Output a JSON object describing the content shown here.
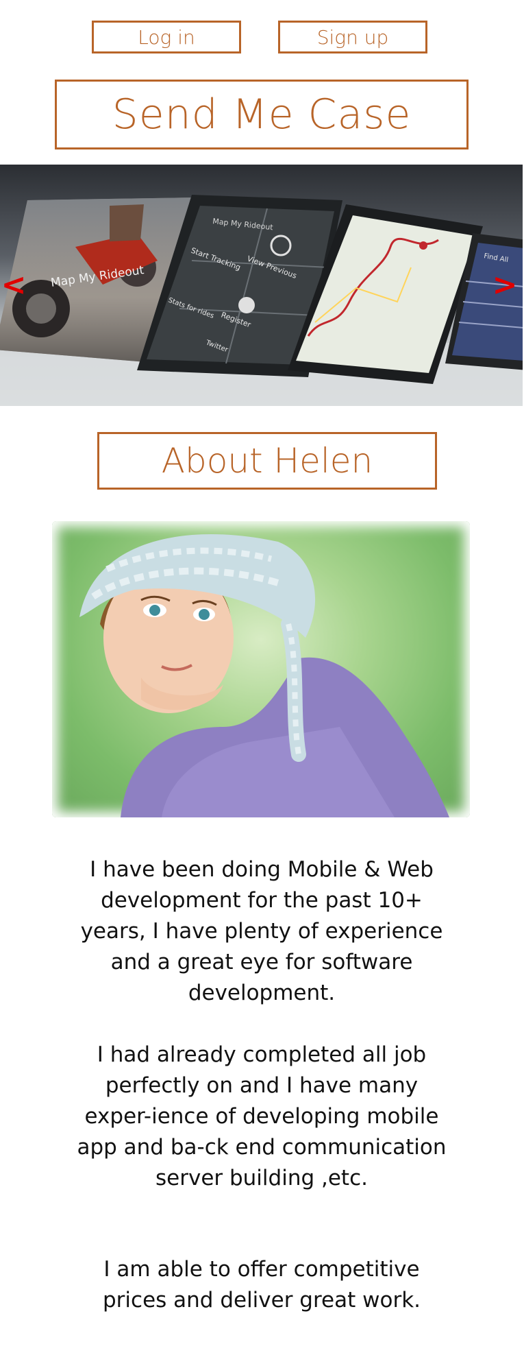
{
  "header": {
    "login_label": "Log in",
    "signup_label": "Sign up"
  },
  "site": {
    "title": "Send Me Case"
  },
  "carousel": {
    "prev_symbol": "<",
    "next_symbol": ">",
    "screen_texts": {
      "brand": "Map My Rideout",
      "app_header": "Map My Rideout",
      "menu_tracking": "Start Tracking",
      "menu_previous": "View Previous",
      "menu_register": "Register",
      "menu_twitter": "Twitter",
      "menu_stats": "Stats for rides",
      "list_header": "Find All"
    }
  },
  "about": {
    "title": "About Helen"
  },
  "bio": {
    "paragraph_1": "I have been doing Mobile & Web development for the past 10+ years, I have plenty of experience and a great eye for software development.",
    "paragraph_2": "I had already completed all job perfectly on  and I have many exper-ience of developing mobile app and ba-ck end communication server building ,etc.",
    "paragraph_3": "I am able to offer competitive prices and deliver great work."
  },
  "colors": {
    "accent": "#b86428",
    "arrow": "#e00000",
    "text": "#111111"
  }
}
